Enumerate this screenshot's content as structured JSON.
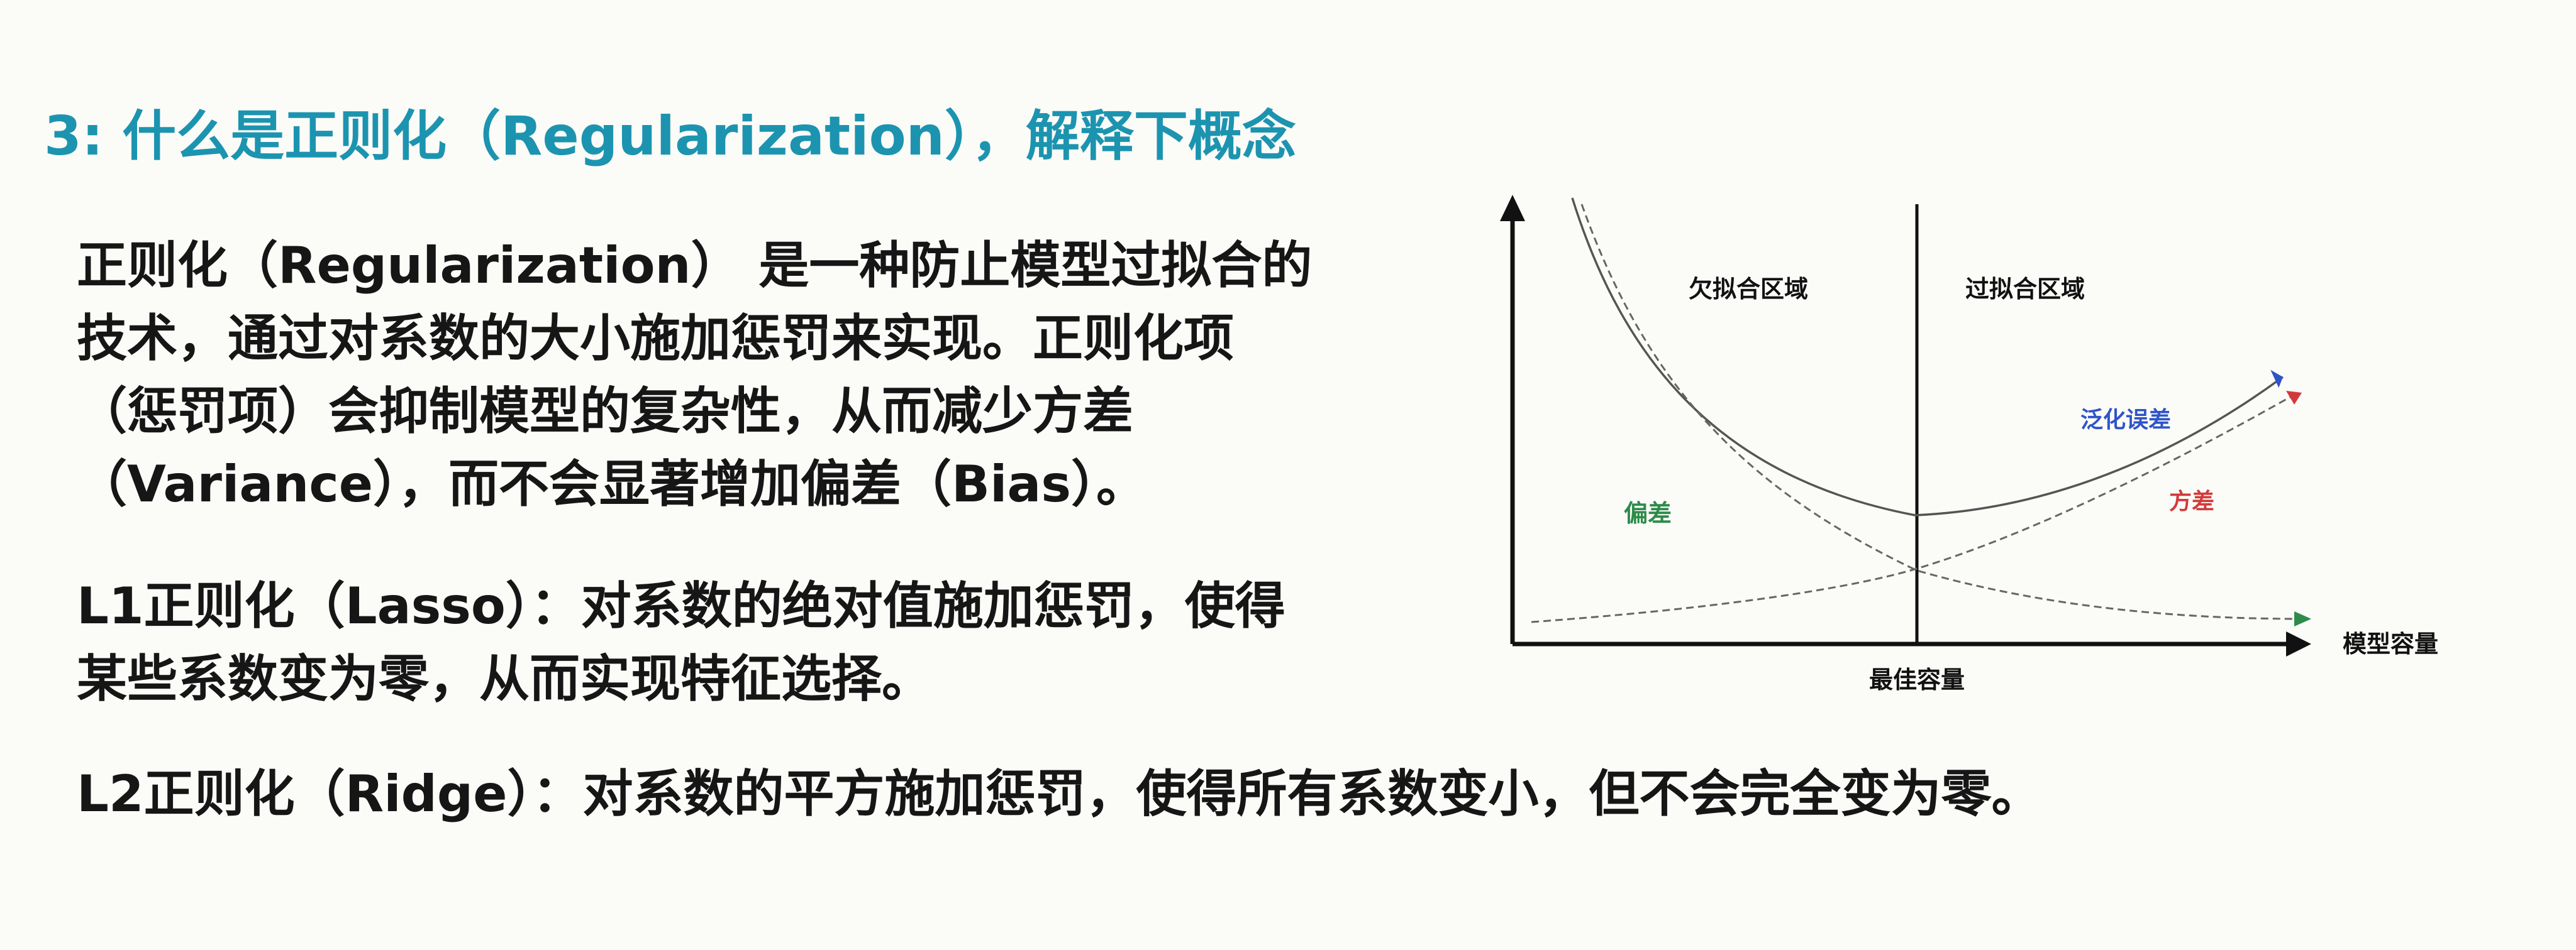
{
  "title": "3: 什么是正则化（Regularization），解释下概念",
  "paragraphs": {
    "definition": "正则化（Regularization） 是一种防止模型过拟合的技术，通过对系数的大小施加惩罚来实现。正则化项（惩罚项）会抑制模型的复杂性，从而减少方差（Variance），而不会显著增加偏差（Bias）。",
    "l1": "L1正则化（Lasso）：对系数的绝对值施加惩罚，使得某些系数变为零，从而实现特征选择。",
    "l2": "L2正则化（Ridge）：对系数的平方施加惩罚，使得所有系数变小，但不会完全变为零。"
  },
  "diagram": {
    "region_left": "欠拟合区域",
    "region_right": "过拟合区域",
    "x_axis_label": "模型容量",
    "optimal_label": "最佳容量",
    "curves": {
      "generalization": "泛化误差",
      "bias": "偏差",
      "variance": "方差"
    },
    "colors": {
      "generalization": "#2f54c9",
      "bias": "#2e8b4a",
      "variance": "#d23a3a",
      "axis": "#111111",
      "curve": "#555555"
    }
  }
}
